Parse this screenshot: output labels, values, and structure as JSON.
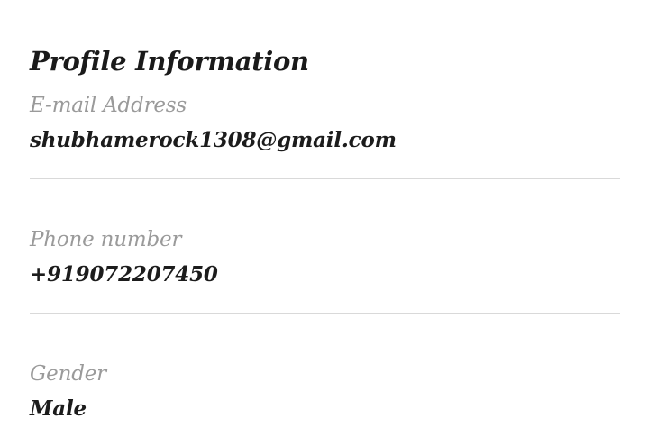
{
  "profile": {
    "title": "Profile Information",
    "fields": [
      {
        "label": "E-mail Address",
        "value": "shubhamerock1308@gmail.com"
      },
      {
        "label": "Phone number",
        "value": "+919072207450"
      },
      {
        "label": "Gender",
        "value": "Male"
      }
    ]
  }
}
